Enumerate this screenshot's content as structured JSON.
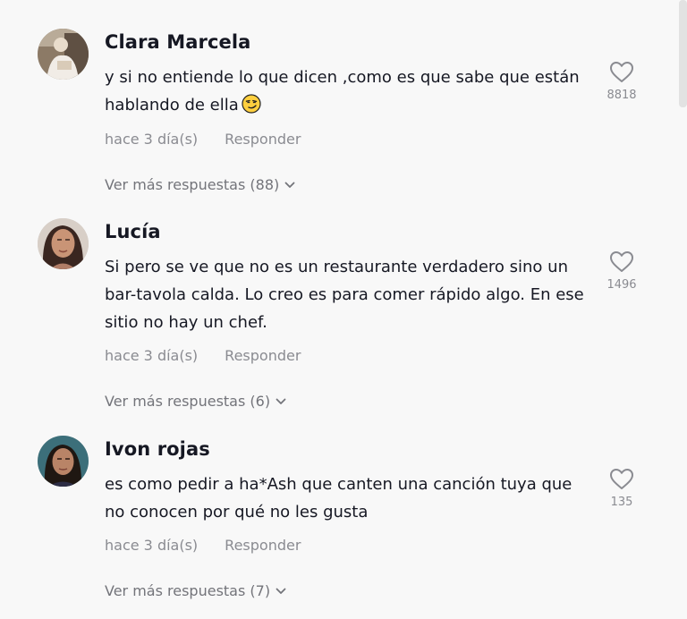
{
  "comments": [
    {
      "username": "Clara Marcela",
      "text": "y si no entiende lo que dicen ,como es que sabe que están hablando de ella",
      "emoji": "smirking-face-emoji",
      "timestamp": "hace 3 día(s)",
      "reply_label": "Responder",
      "likes": "8818",
      "more_replies": "Ver más respuestas (88)",
      "avatar_icon": "avatar-photo"
    },
    {
      "username": "Lucía",
      "text": "Si pero se ve que no es un restaurante verdadero sino un bar-tavola calda. Lo creo es para comer rápido algo. En ese sitio no hay un chef.",
      "timestamp": "hace 3 día(s)",
      "reply_label": "Responder",
      "likes": "1496",
      "more_replies": "Ver más respuestas (6)",
      "avatar_icon": "avatar-photo"
    },
    {
      "username": "Ivon rojas",
      "text": "es como pedir a ha*Ash que canten una canción tuya que no conocen por qué no les gusta",
      "timestamp": "hace 3 día(s)",
      "reply_label": "Responder",
      "likes": "135",
      "more_replies": "Ver más respuestas (7)",
      "avatar_icon": "avatar-photo"
    }
  ],
  "colors": {
    "background": "#f8f8f8",
    "primary_text": "#161823",
    "secondary_text": "#8a8b91",
    "heart_outline": "#8a8b91"
  },
  "icons": {
    "like": "heart-outline-icon",
    "expand": "chevron-down-icon"
  }
}
